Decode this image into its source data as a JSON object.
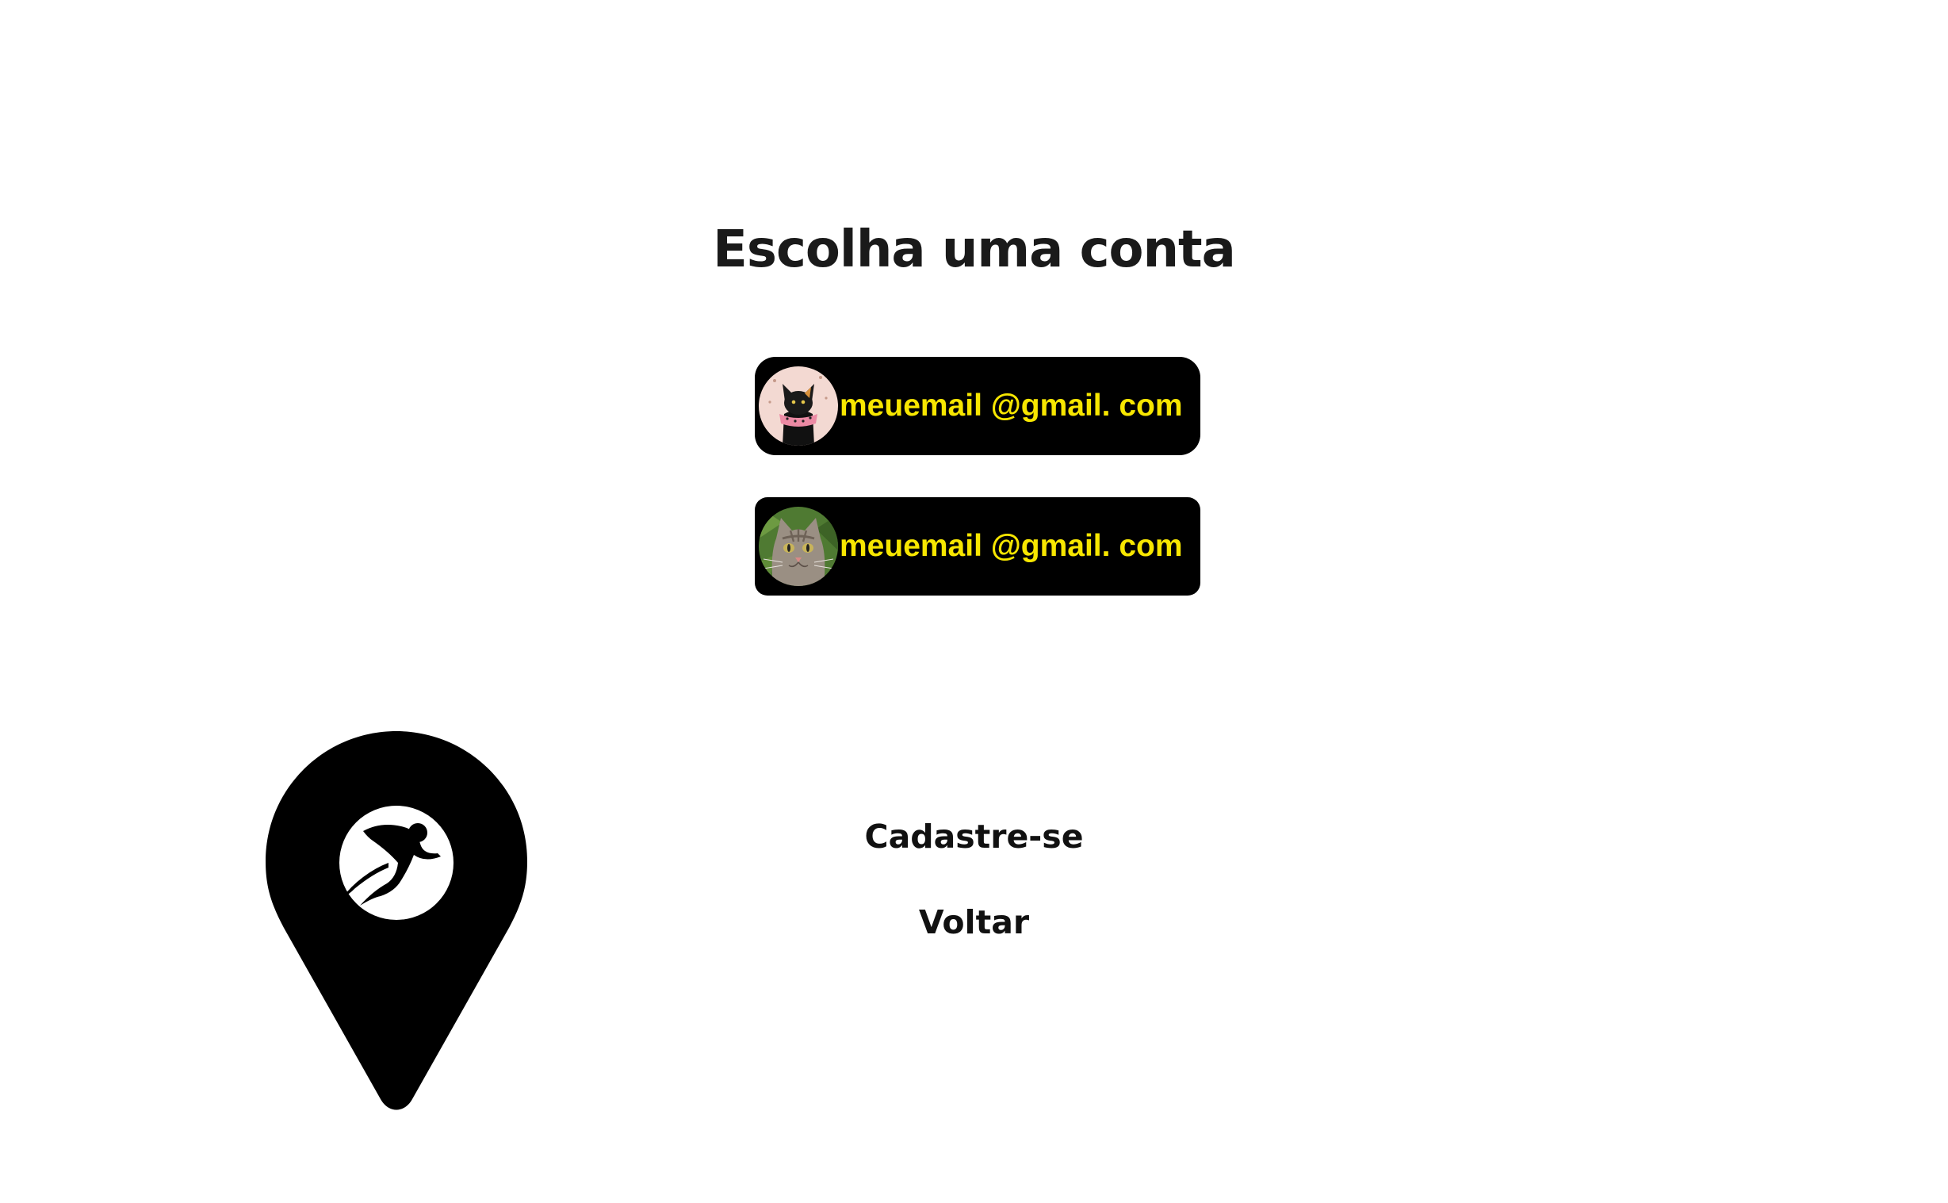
{
  "header": {
    "title": "Escolha uma conta"
  },
  "accounts": [
    {
      "email": "meuemail @gmail. com",
      "avatar_icon": "black-cat-avatar-icon"
    },
    {
      "email": "meuemail @gmail. com",
      "avatar_icon": "tabby-cat-avatar-icon"
    }
  ],
  "links": {
    "signup": "Cadastre-se",
    "back": "Voltar"
  },
  "logo": {
    "icon": "location-pin-runner-logo"
  },
  "colors": {
    "background": "#ffffff",
    "account_bg": "#000000",
    "email_text": "#f7e600",
    "text": "#111111"
  }
}
